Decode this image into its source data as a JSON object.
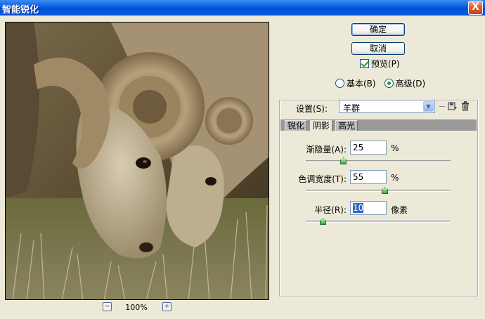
{
  "window": {
    "title": "智能锐化",
    "close_label": "X"
  },
  "preview": {
    "zoom_level": "100%",
    "zoom_out_label": "−",
    "zoom_in_label": "+"
  },
  "buttons": {
    "ok_label": "确定",
    "cancel_label": "取消",
    "preview_label": "预览(P)",
    "preview_checked": true
  },
  "mode": {
    "basic_label": "基本(B)",
    "advanced_label": "高级(D)",
    "selected": "advanced"
  },
  "settings": {
    "label": "设置(S):",
    "value": "羊群"
  },
  "tabs": [
    {
      "label": "锐化",
      "active": false
    },
    {
      "label": "阴影",
      "active": true
    },
    {
      "label": "高光",
      "active": false
    }
  ],
  "params": {
    "fade_amount": {
      "label": "渐隐量(A):",
      "value": "25",
      "unit": "%",
      "level": 0.25
    },
    "tonal_width": {
      "label": "色调宽度(T):",
      "value": "55",
      "unit": "%",
      "level": 0.55
    },
    "radius": {
      "label": "半径(R):",
      "value": "10",
      "unit": "像素",
      "level": 0.1
    }
  },
  "colors": {
    "titlebar": "#0a5fe0",
    "dialog_bg": "#ece9d8",
    "tab_strip": "#999999",
    "slider_thumb": "#3aa63a"
  },
  "icons": {
    "save": "save-preset-icon",
    "delete": "trash-icon"
  }
}
